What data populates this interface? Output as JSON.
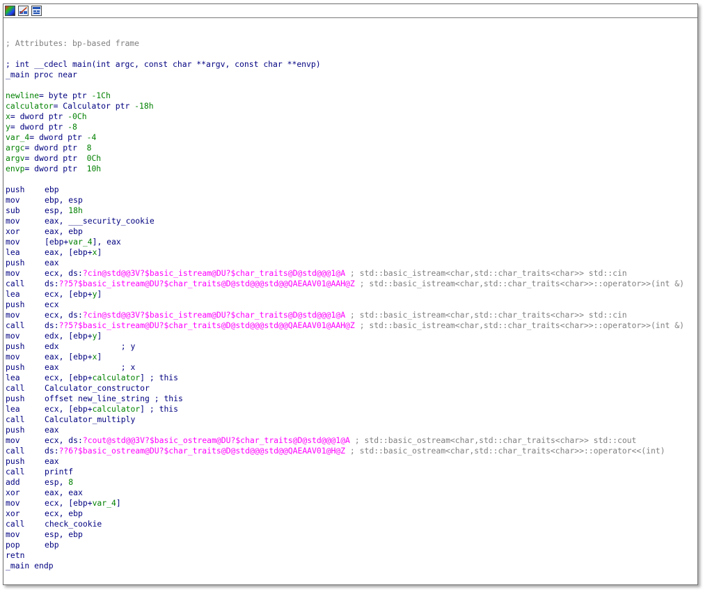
{
  "toolbar": {
    "buttons": [
      {
        "icon": "graph-colors-icon"
      },
      {
        "icon": "edit-graph-icon"
      },
      {
        "icon": "graph-view-icon"
      }
    ]
  },
  "listing": [
    [],
    [
      [
        "; Attributes: bp-based frame",
        "c-comment"
      ]
    ],
    [],
    [
      [
        "; int __cdecl main(int argc, const char **argv, const char **envp)",
        "c-name"
      ]
    ],
    [
      [
        "_main proc near",
        "c-name"
      ]
    ],
    [],
    [
      [
        "newline",
        "c-var"
      ],
      [
        "= byte ptr ",
        "c-ins"
      ],
      [
        "-1Ch",
        "c-num"
      ]
    ],
    [
      [
        "calculator",
        "c-var"
      ],
      [
        "= Calculator ptr ",
        "c-ins"
      ],
      [
        "-18h",
        "c-num"
      ]
    ],
    [
      [
        "x",
        "c-var"
      ],
      [
        "= dword ptr ",
        "c-ins"
      ],
      [
        "-0Ch",
        "c-num"
      ]
    ],
    [
      [
        "y",
        "c-var"
      ],
      [
        "= dword ptr ",
        "c-ins"
      ],
      [
        "-8",
        "c-num"
      ]
    ],
    [
      [
        "var_4",
        "c-var"
      ],
      [
        "= dword ptr ",
        "c-ins"
      ],
      [
        "-4",
        "c-num"
      ]
    ],
    [
      [
        "argc",
        "c-var"
      ],
      [
        "= dword ptr  ",
        "c-ins"
      ],
      [
        "8",
        "c-num"
      ]
    ],
    [
      [
        "argv",
        "c-var"
      ],
      [
        "= dword ptr  ",
        "c-ins"
      ],
      [
        "0Ch",
        "c-num"
      ]
    ],
    [
      [
        "envp",
        "c-var"
      ],
      [
        "= dword ptr  ",
        "c-ins"
      ],
      [
        "10h",
        "c-num"
      ]
    ],
    [],
    [
      [
        "push",
        "mn"
      ],
      [
        "ebp",
        "c-reg"
      ]
    ],
    [
      [
        "mov",
        "mn"
      ],
      [
        "ebp, esp",
        "c-reg"
      ]
    ],
    [
      [
        "sub",
        "mn"
      ],
      [
        "esp, ",
        "c-reg"
      ],
      [
        "18h",
        "c-num"
      ]
    ],
    [
      [
        "mov",
        "mn"
      ],
      [
        "eax, ___security_cookie",
        "c-reg"
      ]
    ],
    [
      [
        "xor",
        "mn"
      ],
      [
        "eax, ebp",
        "c-reg"
      ]
    ],
    [
      [
        "mov",
        "mn"
      ],
      [
        "[ebp+",
        "c-reg"
      ],
      [
        "var_4",
        "c-var"
      ],
      [
        "], eax",
        "c-reg"
      ]
    ],
    [
      [
        "lea",
        "mn"
      ],
      [
        "eax, [ebp+",
        "c-reg"
      ],
      [
        "x",
        "c-var"
      ],
      [
        "]",
        "c-reg"
      ]
    ],
    [
      [
        "push",
        "mn"
      ],
      [
        "eax",
        "c-reg"
      ]
    ],
    [
      [
        "mov",
        "mn"
      ],
      [
        "ecx, ds:",
        "c-reg"
      ],
      [
        "?cin@std@@3V?$basic_istream@DU?$char_traits@D@std@@@1@A",
        "c-sym"
      ],
      [
        " ; std::basic_istream<char,std::char_traits<char>> std::cin",
        "c-comment"
      ]
    ],
    [
      [
        "call",
        "mn"
      ],
      [
        "ds:",
        "c-reg"
      ],
      [
        "??5?$basic_istream@DU?$char_traits@D@std@@@std@@QAEAAV01@AAH@Z",
        "c-sym"
      ],
      [
        " ; std::basic_istream<char,std::char_traits<char>>::operator>>(int &)",
        "c-comment"
      ]
    ],
    [
      [
        "lea",
        "mn"
      ],
      [
        "ecx, [ebp+",
        "c-reg"
      ],
      [
        "y",
        "c-var"
      ],
      [
        "]",
        "c-reg"
      ]
    ],
    [
      [
        "push",
        "mn"
      ],
      [
        "ecx",
        "c-reg"
      ]
    ],
    [
      [
        "mov",
        "mn"
      ],
      [
        "ecx, ds:",
        "c-reg"
      ],
      [
        "?cin@std@@3V?$basic_istream@DU?$char_traits@D@std@@@1@A",
        "c-sym"
      ],
      [
        " ; std::basic_istream<char,std::char_traits<char>> std::cin",
        "c-comment"
      ]
    ],
    [
      [
        "call",
        "mn"
      ],
      [
        "ds:",
        "c-reg"
      ],
      [
        "??5?$basic_istream@DU?$char_traits@D@std@@@std@@QAEAAV01@AAH@Z",
        "c-sym"
      ],
      [
        " ; std::basic_istream<char,std::char_traits<char>>::operator>>(int &)",
        "c-comment"
      ]
    ],
    [
      [
        "mov",
        "mn"
      ],
      [
        "edx, [ebp+",
        "c-reg"
      ],
      [
        "y",
        "c-var"
      ],
      [
        "]",
        "c-reg"
      ]
    ],
    [
      [
        "push",
        "mn"
      ],
      [
        "edx             ; y",
        "c-reg"
      ]
    ],
    [
      [
        "mov",
        "mn"
      ],
      [
        "eax, [ebp+",
        "c-reg"
      ],
      [
        "x",
        "c-var"
      ],
      [
        "]",
        "c-reg"
      ]
    ],
    [
      [
        "push",
        "mn"
      ],
      [
        "eax             ; x",
        "c-reg"
      ]
    ],
    [
      [
        "lea",
        "mn"
      ],
      [
        "ecx, [ebp+",
        "c-reg"
      ],
      [
        "calculator",
        "c-var"
      ],
      [
        "] ; this",
        "c-reg"
      ]
    ],
    [
      [
        "call",
        "mn"
      ],
      [
        "Calculator_constructor",
        "c-lbl"
      ]
    ],
    [
      [
        "push",
        "mn"
      ],
      [
        "offset new_line_string ; this",
        "c-reg"
      ]
    ],
    [
      [
        "lea",
        "mn"
      ],
      [
        "ecx, [ebp+",
        "c-reg"
      ],
      [
        "calculator",
        "c-var"
      ],
      [
        "] ; this",
        "c-reg"
      ]
    ],
    [
      [
        "call",
        "mn"
      ],
      [
        "Calculator_multiply",
        "c-lbl"
      ]
    ],
    [
      [
        "push",
        "mn"
      ],
      [
        "eax",
        "c-reg"
      ]
    ],
    [
      [
        "mov",
        "mn"
      ],
      [
        "ecx, ds:",
        "c-reg"
      ],
      [
        "?cout@std@@3V?$basic_ostream@DU?$char_traits@D@std@@@1@A",
        "c-sym"
      ],
      [
        " ; std::basic_ostream<char,std::char_traits<char>> std::cout",
        "c-comment"
      ]
    ],
    [
      [
        "call",
        "mn"
      ],
      [
        "ds:",
        "c-reg"
      ],
      [
        "??6?$basic_ostream@DU?$char_traits@D@std@@@std@@QAEAAV01@H@Z",
        "c-sym"
      ],
      [
        " ; std::basic_ostream<char,std::char_traits<char>>::operator<<(int)",
        "c-comment"
      ]
    ],
    [
      [
        "push",
        "mn"
      ],
      [
        "eax",
        "c-reg"
      ]
    ],
    [
      [
        "call",
        "mn"
      ],
      [
        "printf",
        "c-lbl"
      ]
    ],
    [
      [
        "add",
        "mn"
      ],
      [
        "esp, ",
        "c-reg"
      ],
      [
        "8",
        "c-num"
      ]
    ],
    [
      [
        "xor",
        "mn"
      ],
      [
        "eax, eax",
        "c-reg"
      ]
    ],
    [
      [
        "mov",
        "mn"
      ],
      [
        "ecx, [ebp+",
        "c-reg"
      ],
      [
        "var_4",
        "c-var"
      ],
      [
        "]",
        "c-reg"
      ]
    ],
    [
      [
        "xor",
        "mn"
      ],
      [
        "ecx, ebp",
        "c-reg"
      ]
    ],
    [
      [
        "call",
        "mn"
      ],
      [
        "check_cookie",
        "c-lbl"
      ]
    ],
    [
      [
        "mov",
        "mn"
      ],
      [
        "esp, ebp",
        "c-reg"
      ]
    ],
    [
      [
        "pop",
        "mn"
      ],
      [
        "ebp",
        "c-reg"
      ]
    ],
    [
      [
        "retn",
        "mn"
      ]
    ],
    [
      [
        "_main endp",
        "c-name"
      ]
    ]
  ]
}
